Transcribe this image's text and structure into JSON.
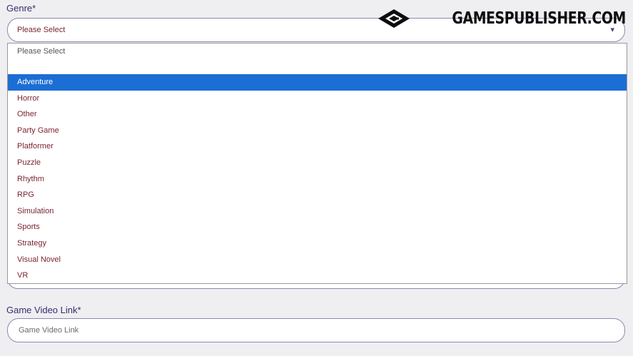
{
  "genre": {
    "label": "Genre*",
    "selected_value": "Please Select",
    "options": [
      "Please Select",
      "Adventure",
      "Horror",
      "Other",
      "Party Game",
      "Platformer",
      "Puzzle",
      "Rhythm",
      "RPG",
      "Simulation",
      "Sports",
      "Strategy",
      "Visual Novel",
      "VR"
    ],
    "highlighted_option": "Adventure"
  },
  "video_link": {
    "label": "Game Video Link*",
    "placeholder": "Game Video Link"
  },
  "watermark": {
    "text": "GAMESPUBLISHER.COM"
  },
  "icons": {
    "caret": "chevron-down-icon",
    "logo": "gamespublisher-logo-icon"
  },
  "colors": {
    "background": "#efeff1",
    "option_text": "#7a2430",
    "highlight": "#1c6ed4",
    "label_text": "#3b2a6e",
    "border": "#8e87b0"
  }
}
